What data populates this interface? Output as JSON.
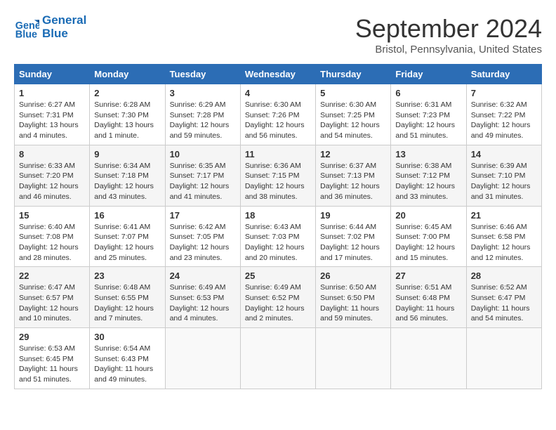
{
  "header": {
    "logo_line1": "General",
    "logo_line2": "Blue",
    "month": "September 2024",
    "location": "Bristol, Pennsylvania, United States"
  },
  "weekdays": [
    "Sunday",
    "Monday",
    "Tuesday",
    "Wednesday",
    "Thursday",
    "Friday",
    "Saturday"
  ],
  "weeks": [
    [
      {
        "day": "1",
        "info": "Sunrise: 6:27 AM\nSunset: 7:31 PM\nDaylight: 13 hours\nand 4 minutes."
      },
      {
        "day": "2",
        "info": "Sunrise: 6:28 AM\nSunset: 7:30 PM\nDaylight: 13 hours\nand 1 minute."
      },
      {
        "day": "3",
        "info": "Sunrise: 6:29 AM\nSunset: 7:28 PM\nDaylight: 12 hours\nand 59 minutes."
      },
      {
        "day": "4",
        "info": "Sunrise: 6:30 AM\nSunset: 7:26 PM\nDaylight: 12 hours\nand 56 minutes."
      },
      {
        "day": "5",
        "info": "Sunrise: 6:30 AM\nSunset: 7:25 PM\nDaylight: 12 hours\nand 54 minutes."
      },
      {
        "day": "6",
        "info": "Sunrise: 6:31 AM\nSunset: 7:23 PM\nDaylight: 12 hours\nand 51 minutes."
      },
      {
        "day": "7",
        "info": "Sunrise: 6:32 AM\nSunset: 7:22 PM\nDaylight: 12 hours\nand 49 minutes."
      }
    ],
    [
      {
        "day": "8",
        "info": "Sunrise: 6:33 AM\nSunset: 7:20 PM\nDaylight: 12 hours\nand 46 minutes."
      },
      {
        "day": "9",
        "info": "Sunrise: 6:34 AM\nSunset: 7:18 PM\nDaylight: 12 hours\nand 43 minutes."
      },
      {
        "day": "10",
        "info": "Sunrise: 6:35 AM\nSunset: 7:17 PM\nDaylight: 12 hours\nand 41 minutes."
      },
      {
        "day": "11",
        "info": "Sunrise: 6:36 AM\nSunset: 7:15 PM\nDaylight: 12 hours\nand 38 minutes."
      },
      {
        "day": "12",
        "info": "Sunrise: 6:37 AM\nSunset: 7:13 PM\nDaylight: 12 hours\nand 36 minutes."
      },
      {
        "day": "13",
        "info": "Sunrise: 6:38 AM\nSunset: 7:12 PM\nDaylight: 12 hours\nand 33 minutes."
      },
      {
        "day": "14",
        "info": "Sunrise: 6:39 AM\nSunset: 7:10 PM\nDaylight: 12 hours\nand 31 minutes."
      }
    ],
    [
      {
        "day": "15",
        "info": "Sunrise: 6:40 AM\nSunset: 7:08 PM\nDaylight: 12 hours\nand 28 minutes."
      },
      {
        "day": "16",
        "info": "Sunrise: 6:41 AM\nSunset: 7:07 PM\nDaylight: 12 hours\nand 25 minutes."
      },
      {
        "day": "17",
        "info": "Sunrise: 6:42 AM\nSunset: 7:05 PM\nDaylight: 12 hours\nand 23 minutes."
      },
      {
        "day": "18",
        "info": "Sunrise: 6:43 AM\nSunset: 7:03 PM\nDaylight: 12 hours\nand 20 minutes."
      },
      {
        "day": "19",
        "info": "Sunrise: 6:44 AM\nSunset: 7:02 PM\nDaylight: 12 hours\nand 17 minutes."
      },
      {
        "day": "20",
        "info": "Sunrise: 6:45 AM\nSunset: 7:00 PM\nDaylight: 12 hours\nand 15 minutes."
      },
      {
        "day": "21",
        "info": "Sunrise: 6:46 AM\nSunset: 6:58 PM\nDaylight: 12 hours\nand 12 minutes."
      }
    ],
    [
      {
        "day": "22",
        "info": "Sunrise: 6:47 AM\nSunset: 6:57 PM\nDaylight: 12 hours\nand 10 minutes."
      },
      {
        "day": "23",
        "info": "Sunrise: 6:48 AM\nSunset: 6:55 PM\nDaylight: 12 hours\nand 7 minutes."
      },
      {
        "day": "24",
        "info": "Sunrise: 6:49 AM\nSunset: 6:53 PM\nDaylight: 12 hours\nand 4 minutes."
      },
      {
        "day": "25",
        "info": "Sunrise: 6:49 AM\nSunset: 6:52 PM\nDaylight: 12 hours\nand 2 minutes."
      },
      {
        "day": "26",
        "info": "Sunrise: 6:50 AM\nSunset: 6:50 PM\nDaylight: 11 hours\nand 59 minutes."
      },
      {
        "day": "27",
        "info": "Sunrise: 6:51 AM\nSunset: 6:48 PM\nDaylight: 11 hours\nand 56 minutes."
      },
      {
        "day": "28",
        "info": "Sunrise: 6:52 AM\nSunset: 6:47 PM\nDaylight: 11 hours\nand 54 minutes."
      }
    ],
    [
      {
        "day": "29",
        "info": "Sunrise: 6:53 AM\nSunset: 6:45 PM\nDaylight: 11 hours\nand 51 minutes."
      },
      {
        "day": "30",
        "info": "Sunrise: 6:54 AM\nSunset: 6:43 PM\nDaylight: 11 hours\nand 49 minutes."
      },
      null,
      null,
      null,
      null,
      null
    ]
  ]
}
